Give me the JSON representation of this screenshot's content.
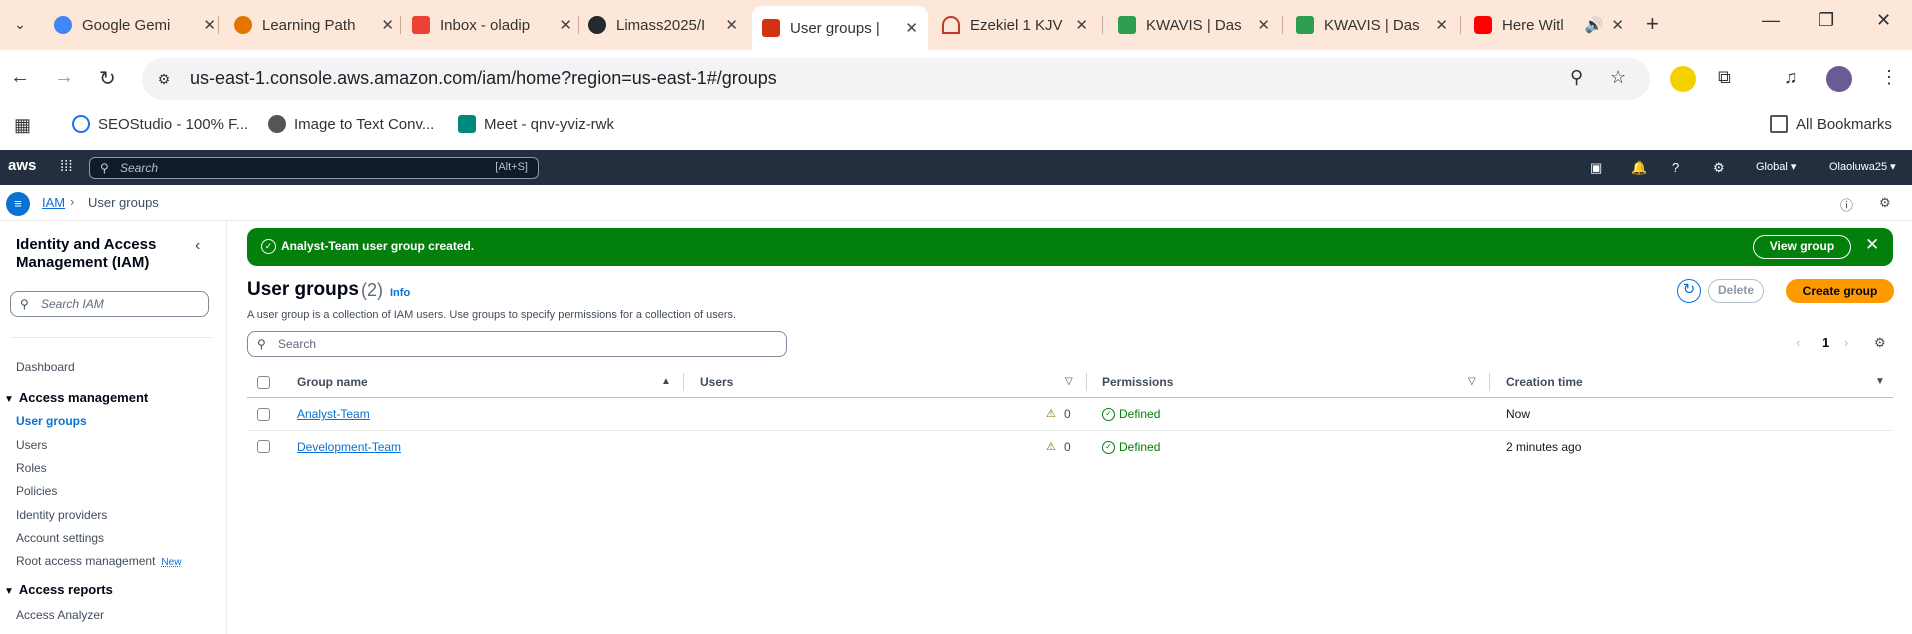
{
  "browser": {
    "tabs": [
      {
        "title": "Google Gemi",
        "favicon": "gemini-icon",
        "color": "#4285f4"
      },
      {
        "title": "Learning Path",
        "favicon": "learning-icon",
        "color": "#e37400"
      },
      {
        "title": "Inbox - oladip",
        "favicon": "gmail-icon",
        "color": "#ea4335"
      },
      {
        "title": "Limass2025/I",
        "favicon": "github-icon",
        "color": "#24292f"
      },
      {
        "title": "User groups |",
        "favicon": "aws-icon",
        "color": "#d13212"
      },
      {
        "title": "Ezekiel 1 KJV",
        "favicon": "bible-icon",
        "color": "#c0392b"
      },
      {
        "title": "KWAVIS | Das",
        "favicon": "kwavis-icon",
        "color": "#2e9e4f"
      },
      {
        "title": "KWAVIS | Das",
        "favicon": "kwavis-icon",
        "color": "#2e9e4f"
      },
      {
        "title": "Here Witl",
        "favicon": "youtube-icon",
        "color": "#ff0000"
      }
    ],
    "url": "us-east-1.console.aws.amazon.com/iam/home?region=us-east-1#/groups",
    "bookmarks": [
      {
        "label": "SEOStudio - 100% F...",
        "icon": "seostudio-icon"
      },
      {
        "label": "Image to Text Conv...",
        "icon": "image-to-text-icon"
      },
      {
        "label": "Meet - qnv-yviz-rwk",
        "icon": "meet-icon"
      }
    ],
    "all_bookmarks": "All Bookmarks"
  },
  "aws_header": {
    "logo": "aws",
    "search_placeholder": "Search",
    "search_shortcut": "[Alt+S]",
    "region": "Global ▾",
    "account": "Olaoluwa25 ▾"
  },
  "breadcrumb": {
    "root": "IAM",
    "current": "User groups"
  },
  "sidebar": {
    "title": "Identity and Access Management (IAM)",
    "search_placeholder": "Search IAM",
    "dashboard": "Dashboard",
    "section_access_management": "Access management",
    "items": [
      {
        "label": "User groups",
        "active": true
      },
      {
        "label": "Users"
      },
      {
        "label": "Roles"
      },
      {
        "label": "Policies"
      },
      {
        "label": "Identity providers"
      },
      {
        "label": "Account settings"
      },
      {
        "label": "Root access management",
        "badge": "New"
      }
    ],
    "section_access_reports": "Access reports",
    "report_items": [
      {
        "label": "Access Analyzer"
      }
    ]
  },
  "flash": {
    "message": "Analyst-Team user group created.",
    "action": "View group"
  },
  "main": {
    "title": "User groups",
    "count": "(2)",
    "info": "Info",
    "description": "A user group is a collection of IAM users. Use groups to specify permissions for a collection of users.",
    "delete_label": "Delete",
    "create_label": "Create group",
    "search_placeholder": "Search",
    "page": "1"
  },
  "table": {
    "columns": [
      "Group name",
      "Users",
      "Permissions",
      "Creation time"
    ],
    "rows": [
      {
        "name": "Analyst-Team",
        "users": "0",
        "permissions": "Defined",
        "created": "Now"
      },
      {
        "name": "Development-Team",
        "users": "0",
        "permissions": "Defined",
        "created": "2 minutes ago"
      }
    ]
  },
  "colors": {
    "aws_nav": "#232f3e",
    "link_blue": "#0972d3",
    "success_green": "#037f0c",
    "primary_orange": "#ff9900",
    "chrome_tabstrip": "#fde7d8"
  }
}
